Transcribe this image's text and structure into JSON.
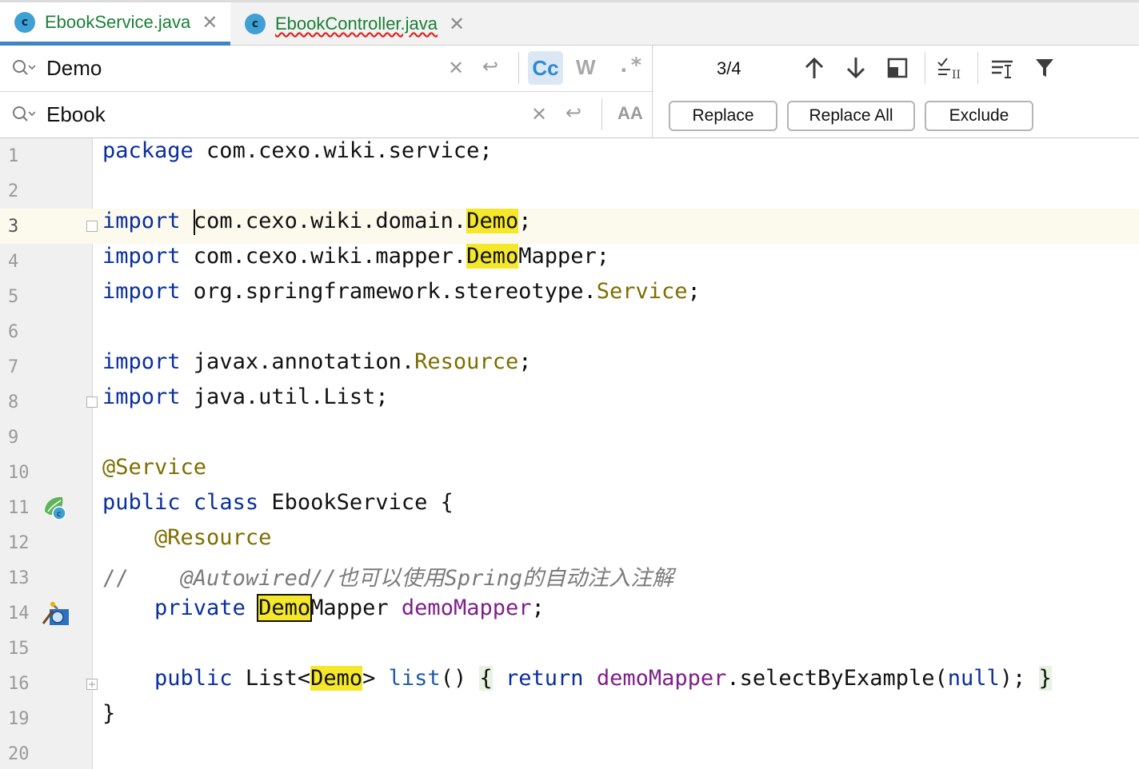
{
  "tabs": [
    {
      "label": "EbookService.java",
      "icon_letter": "c"
    },
    {
      "label": "EbookController.java",
      "icon_letter": "c"
    }
  ],
  "search": {
    "query": "Demo",
    "replace": "Ebook",
    "match_case_label": "Cc",
    "words_label": "W",
    "regex_label": ".*",
    "preserve_case_label": "AA",
    "counter": "3/4",
    "replace_button": "Replace",
    "replace_all_button": "Replace All",
    "exclude_button": "Exclude"
  },
  "editor": {
    "line_numbers": [
      "1",
      "2",
      "3",
      "4",
      "5",
      "6",
      "7",
      "8",
      "9",
      "10",
      "11",
      "12",
      "13",
      "14",
      "15",
      "16",
      "19",
      "20"
    ],
    "lines": {
      "l1": {
        "kw": "package",
        "rest": " com.cexo.wiki.service;"
      },
      "l3": {
        "kw": "import",
        "pre": "com.cexo.wiki.domain.",
        "hit": "Demo",
        "post": ";"
      },
      "l4": {
        "kw": "import",
        "pre": " com.cexo.wiki.mapper.",
        "hit": "Demo",
        "post": "Mapper;"
      },
      "l5": {
        "kw": "import",
        "pre": " org.springframework.stereotype.",
        "cls": "Service",
        "post": ";"
      },
      "l7": {
        "kw": "import",
        "pre": " javax.annotation.",
        "cls": "Resource",
        "post": ";"
      },
      "l8": {
        "kw": "import",
        "rest": " java.util.List;"
      },
      "l10": {
        "ann": "@Service"
      },
      "l11": {
        "kw1": "public",
        "kw2": "class",
        "rest": " EbookService {"
      },
      "l12": {
        "ann": "@Resource"
      },
      "l13": {
        "slashes": "//",
        "comment": "@Autowired//也可以使用Spring的自动注入注解"
      },
      "l14": {
        "kw": "private",
        "hit": "Demo",
        "type_rest": "Mapper ",
        "field": "demoMapper",
        "post": ";"
      },
      "l16": {
        "kw": "public",
        "type_pre": " List<",
        "hit": "Demo",
        "type_post": "> ",
        "method": "list",
        "parens": "() ",
        "open": "{",
        "ret": "return",
        "field": "demoMapper",
        "call": ".selectByExample(",
        "nullkw": "null",
        "end": "); ",
        "close": "}"
      },
      "l19": {
        "rest": "}"
      }
    }
  },
  "colors": {
    "accent": "#4083c9",
    "keyword": "#0a2e9e",
    "annotation": "#7d6e00",
    "highlight": "#f5e72a"
  }
}
